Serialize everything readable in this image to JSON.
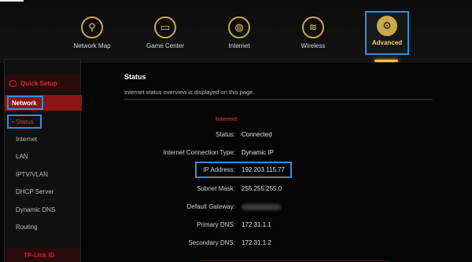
{
  "nav": {
    "items": [
      {
        "label": "Network Map",
        "icon": "network-map-icon",
        "glyph": "⚲"
      },
      {
        "label": "Game Center",
        "icon": "gamepad-icon",
        "glyph": "🎮"
      },
      {
        "label": "Internet",
        "icon": "globe-icon",
        "glyph": "🌐"
      },
      {
        "label": "Wireless",
        "icon": "wifi-icon",
        "glyph": "📶"
      },
      {
        "label": "Advanced",
        "icon": "gear-icon",
        "glyph": "⚙"
      }
    ]
  },
  "sidebar": {
    "quick_setup": "Quick Setup",
    "network": "Network",
    "items": [
      "• Status",
      "Internet",
      "LAN",
      "IPTV/VLAN",
      "DHCP Server",
      "Dynamic DNS",
      "Routing"
    ],
    "footer": "TP-Link ID"
  },
  "main": {
    "title": "Status",
    "description": "Internet status overview is displayed on this page.",
    "section": "Internet",
    "rows": [
      {
        "label": "Status:",
        "value": "Connected"
      },
      {
        "label": "Internet Connection Type:",
        "value": "Dynamic IP"
      },
      {
        "label": "IP Address:",
        "value": "192.203.115.77"
      },
      {
        "label": "Subnet Mask:",
        "value": "255.255.255.0"
      },
      {
        "label": "Default Gateway:",
        "value": ""
      },
      {
        "label": "Primary DNS:",
        "value": "172.31.1.1"
      },
      {
        "label": "Secondary DNS:",
        "value": "172.31.1.2"
      }
    ]
  },
  "colors": {
    "accent_gold": "#c9a94a",
    "accent_red": "#d02626",
    "highlight_blue": "#2f8fe0"
  }
}
